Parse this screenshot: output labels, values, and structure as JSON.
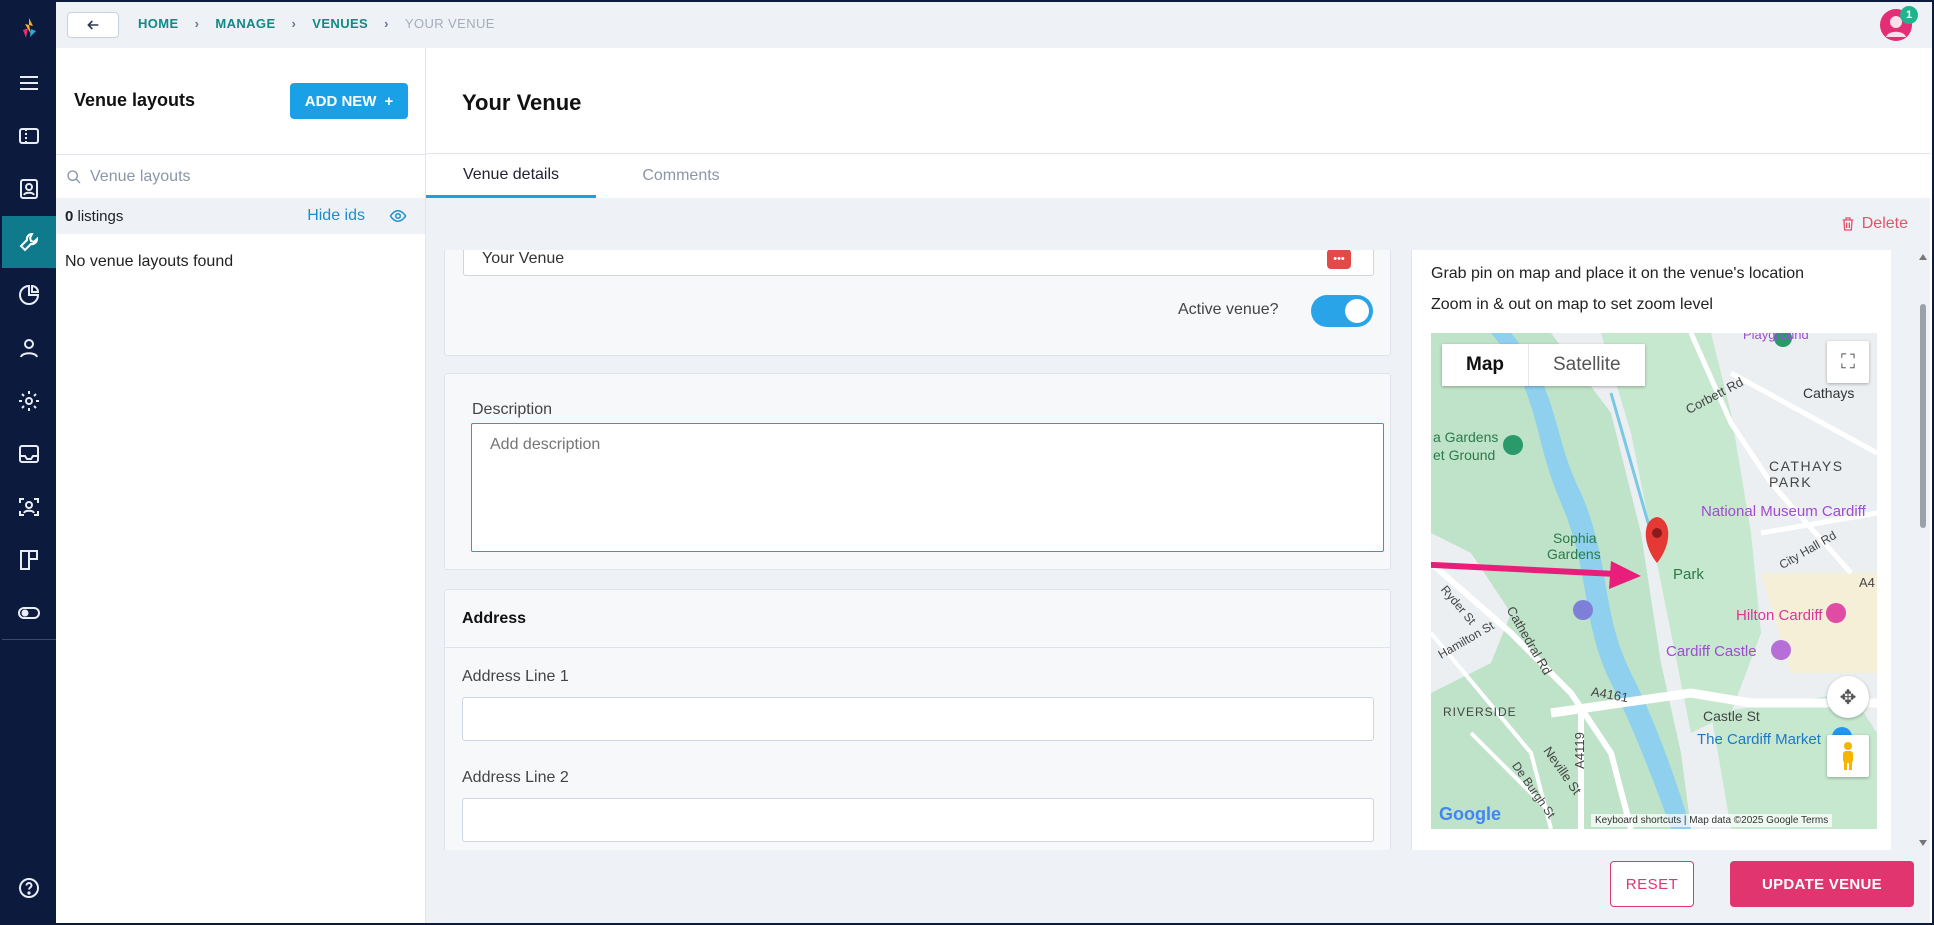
{
  "topbar": {
    "breadcrumb": [
      "HOME",
      "MANAGE",
      "VENUES",
      "YOUR VENUE"
    ],
    "notification_count": "1"
  },
  "list_panel": {
    "title": "Venue layouts",
    "add_new_label": "ADD NEW",
    "search_placeholder": "Venue layouts",
    "count_number": "0",
    "count_suffix": "listings",
    "hide_ids_label": "Hide ids",
    "empty_message": "No venue layouts found"
  },
  "main": {
    "title": "Your Venue",
    "tabs": [
      "Venue details",
      "Comments"
    ],
    "delete_label": "Delete",
    "name_value": "Your Venue",
    "active_label": "Active venue?",
    "active_value": true,
    "description_label": "Description",
    "description_placeholder": "Add description",
    "address_heading": "Address",
    "address_line1_label": "Address Line 1",
    "address_line2_label": "Address Line 2"
  },
  "map": {
    "hint1": "Grab pin on map and place it on the venue's location",
    "hint2": "Zoom in & out on map to set zoom level",
    "type_map": "Map",
    "type_satellite": "Satellite",
    "labels": {
      "playground": "Playground",
      "cathays": "Cathays",
      "corbett": "Corbett Rd",
      "gardens": "a Gardens",
      "ground": "et Ground",
      "cathays_park": "CATHAYS PARK",
      "museum": "National Museum Cardiff",
      "city_hall": "City Hall Rd",
      "sophia": "Sophia",
      "sophia2": "Gardens",
      "park": "Park",
      "ryder": "Ryder St",
      "hamilton": "Hamilton St",
      "cathedral": "Cathedral Rd",
      "hilton": "Hilton Cardiff",
      "castle": "Cardiff Castle",
      "riverside": "RIVERSIDE",
      "a4161": "A4161",
      "castle_st": "Castle St",
      "a4119": "A4119",
      "neville": "Neville St",
      "deburgh": "De Burgh St",
      "market": "The Cardiff Market",
      "a4": "A4"
    },
    "footer": "Keyboard shortcuts  |  Map data ©2025 Google     Terms",
    "google": "Google"
  },
  "footer": {
    "reset_label": "RESET",
    "update_label": "UPDATE VENUE"
  },
  "colors": {
    "rail": "#0b1a3d",
    "accent_blue": "#1aa0e6",
    "accent_pink": "#e0356f",
    "teal_active": "#0f7a8c"
  }
}
